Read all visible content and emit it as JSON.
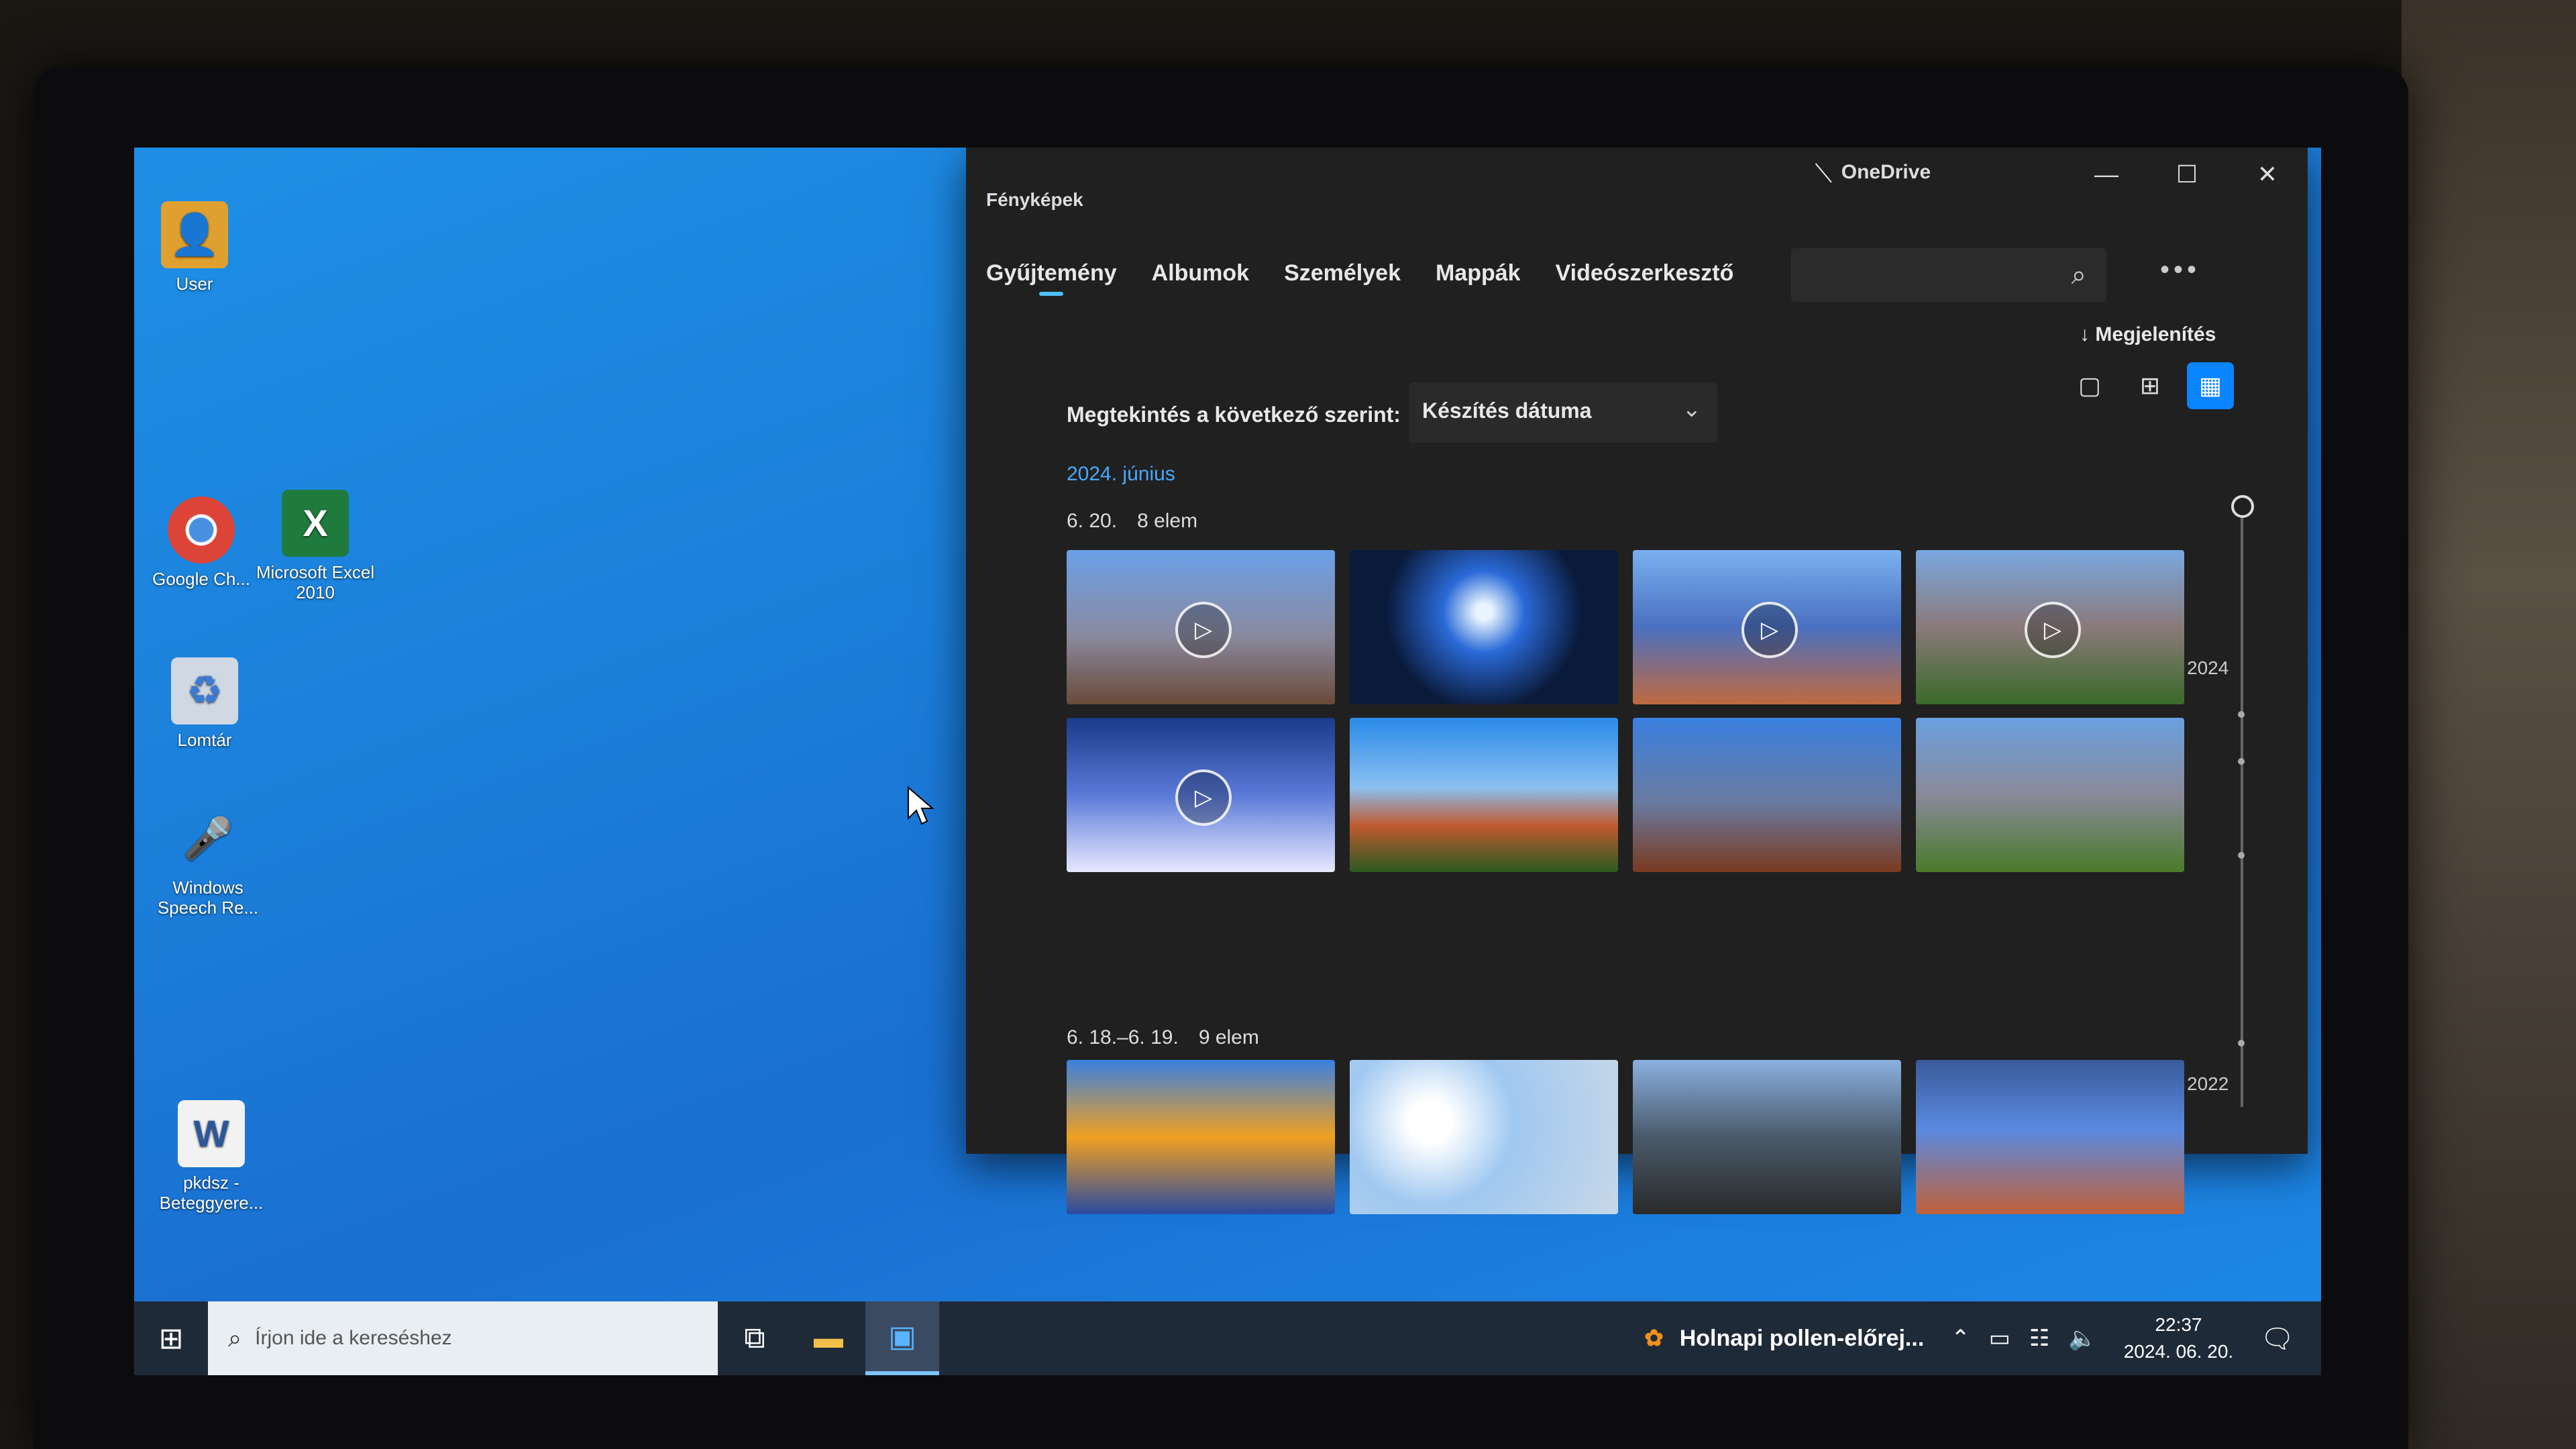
{
  "desktop": {
    "icons": [
      {
        "label": "User",
        "icon": "user-folder-icon"
      },
      {
        "label": "Google Ch...",
        "icon": "chrome-icon"
      },
      {
        "label": "Microsoft Excel 2010",
        "icon": "excel-icon"
      },
      {
        "label": "Lomtár",
        "icon": "recycle-bin-icon"
      },
      {
        "label": "Windows Speech Re...",
        "icon": "microphone-icon"
      },
      {
        "label": "pkdsz - Beteggyere...",
        "icon": "word-document-icon"
      }
    ]
  },
  "photos": {
    "title": "Fényképek",
    "onedrive": "OneDrive",
    "tabs": [
      "Gyűjtemény",
      "Albumok",
      "Személyek",
      "Mappák",
      "Videószerkesztő"
    ],
    "active_tab": 0,
    "display_label": "Megjelenítés",
    "sort_label": "Megtekintés a következő szerint:",
    "sort_value": "Készítés dátuma",
    "month": "2024. június",
    "groups": [
      {
        "date": "6. 20.",
        "count": "8 elem"
      },
      {
        "date": "6. 18.–6. 19.",
        "count": "9 elem"
      }
    ],
    "timeline": {
      "top_year": "2024",
      "bottom_year": "2022"
    }
  },
  "taskbar": {
    "search_placeholder": "Írjon ide a kereséshez",
    "weather_text": "Holnapi pollen-előrej...",
    "time": "22:37",
    "date": "2024. 06. 20."
  },
  "colors": {
    "accent": "#0a84ff",
    "month_link": "#4aa8ff",
    "desktop": "#1b7fda"
  }
}
